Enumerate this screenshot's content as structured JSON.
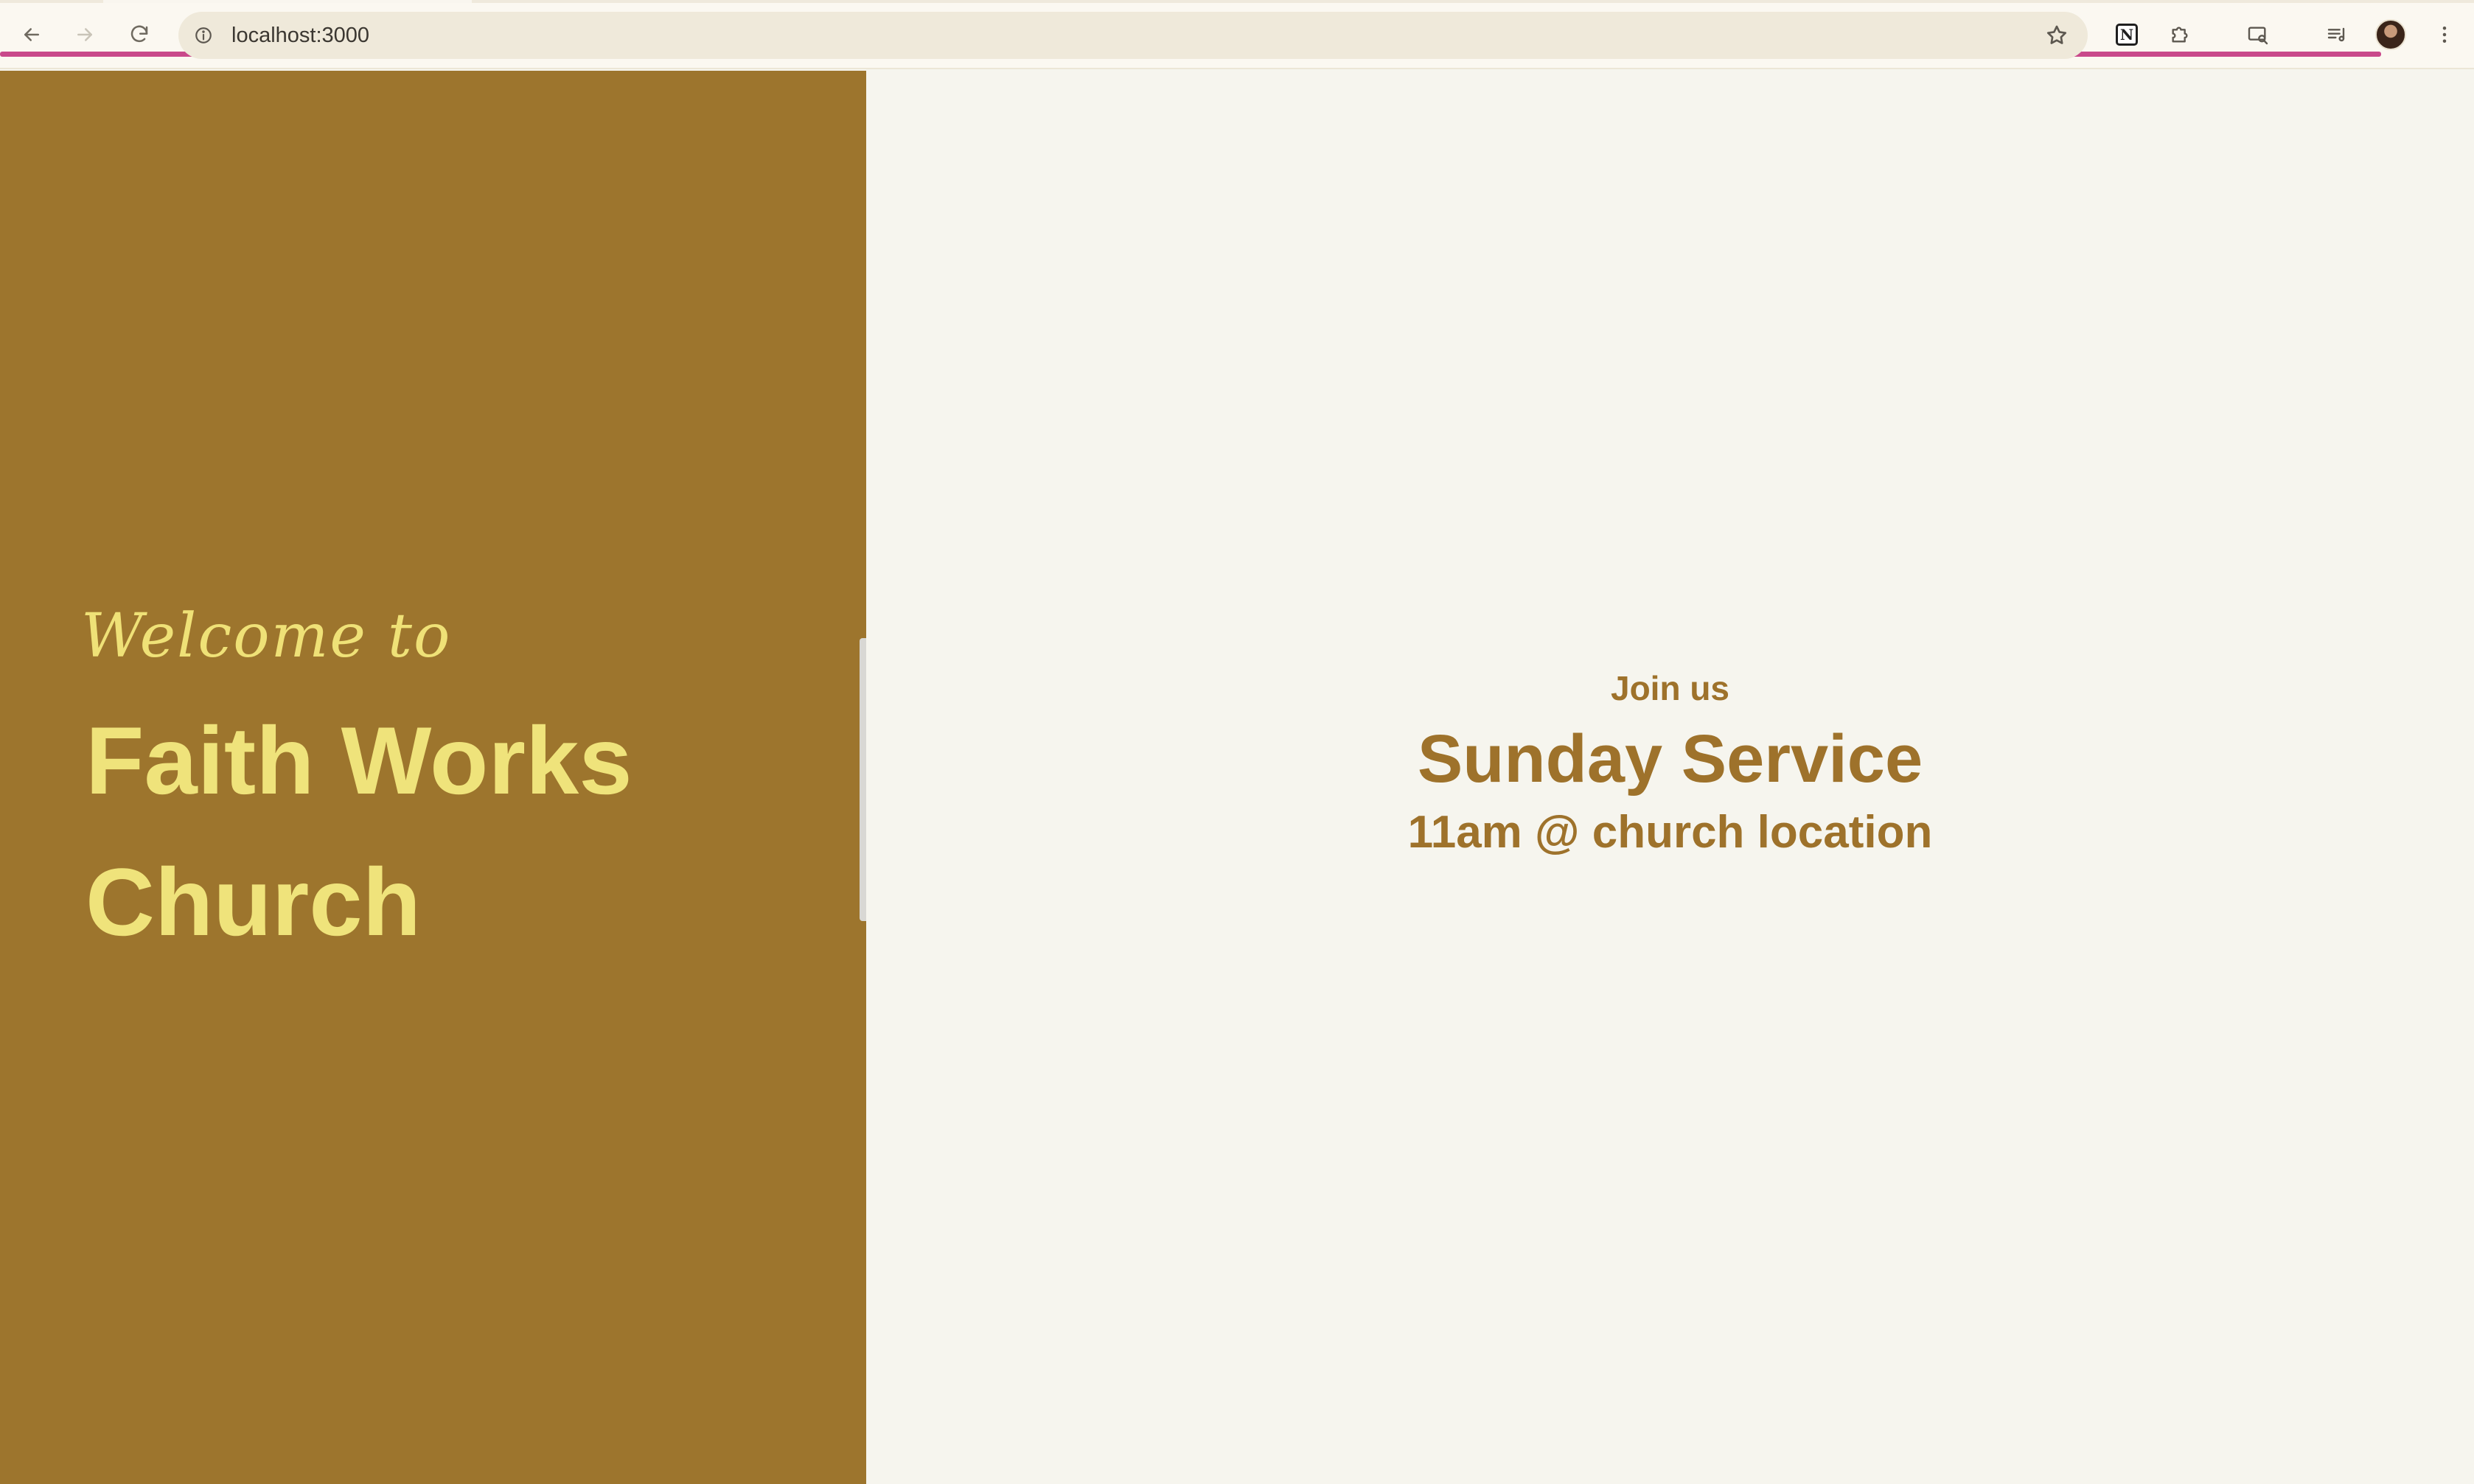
{
  "browser": {
    "url": "localhost:3000"
  },
  "hero": {
    "welcome": "Welcome to",
    "church_name": "Faith Works Church"
  },
  "service": {
    "join_label": "Join us",
    "title": "Sunday Service",
    "time_location": "11am @ church location"
  },
  "colors": {
    "left_panel": "#9d752d",
    "hero_text": "#efe37b",
    "right_panel": "#f6f5ee",
    "service_text": "#9e722b",
    "browser_accent": "#c9498b"
  },
  "icons": {
    "back": "back-arrow-icon",
    "forward": "forward-arrow-icon",
    "reload": "reload-icon",
    "site_info": "info-icon",
    "bookmark": "star-icon",
    "notion": "notion-icon",
    "extensions": "puzzle-icon",
    "search_tab": "tab-search-icon",
    "media": "media-queue-icon",
    "menu": "kebab-menu-icon"
  }
}
